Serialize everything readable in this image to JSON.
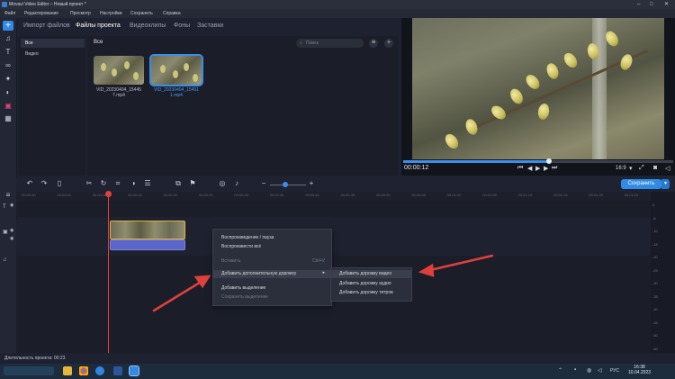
{
  "window": {
    "title": "Movavi Video Editor – Новый проект *"
  },
  "menu": [
    "Файл",
    "Редактирование",
    "Просмотр",
    "Настройки",
    "Сохранить",
    "Справка"
  ],
  "tabs": [
    "Импорт файлов",
    "Файлы проекта",
    "Видеоклипы",
    "Фоны",
    "Заставки"
  ],
  "media": {
    "categories": [
      "Все",
      "Видео"
    ],
    "header": "Все",
    "search_placeholder": "Поиск",
    "files": [
      {
        "name_line1": "VID_20230404_15445",
        "name_line2": "7.mp4",
        "selected": false
      },
      {
        "name_line1": "VID_20230404_15451",
        "name_line2": "1.mp4",
        "selected": true
      }
    ]
  },
  "player": {
    "timecode": "00:00:12",
    "aspect": "16:9",
    "progress": 0.54
  },
  "toolbar": {
    "save_label": "Сохранить"
  },
  "ruler": [
    "00:00:00",
    "00:00:05",
    "00:00:10",
    "00:00:15",
    "00:00:20",
    "00:00:25",
    "00:00:30",
    "00:00:35",
    "00:00:40",
    "00:00:45",
    "00:00:50",
    "00:00:55",
    "00:01:00",
    "00:01:05",
    "00:01:10",
    "00:01:15",
    "00:01:20",
    "00:01:25"
  ],
  "vu_scale": [
    "0",
    "-5",
    "-10",
    "-15",
    "-20",
    "-25",
    "-30",
    "-35",
    "-40",
    "-45",
    "-50",
    "-60"
  ],
  "context_menu": {
    "items": [
      {
        "label": "Воспроизведение / пауза",
        "shortcut": "",
        "disabled": false
      },
      {
        "label": "Воспроизвести всё",
        "shortcut": "",
        "disabled": false
      },
      {
        "label": "Вставить",
        "shortcut": "Ctrl+V",
        "disabled": true
      },
      {
        "label": "Добавить дополнительную дорожку",
        "shortcut": "",
        "disabled": false,
        "highlighted": true
      },
      {
        "label": "Добавить выделение",
        "shortcut": "",
        "disabled": false
      },
      {
        "label": "Сохранить выделение",
        "shortcut": "",
        "disabled": true
      }
    ],
    "submenu": [
      "Добавить дорожку видео",
      "Добавить дорожку аудио",
      "Добавить дорожку титров"
    ]
  },
  "status": {
    "duration_label": "Длительность проекта: 00:23"
  },
  "taskbar": {
    "time": "16:38",
    "date": "10.04.2023",
    "lang": "РУС"
  },
  "colors": {
    "accent": "#2f8be6",
    "playhead": "#e0403c",
    "clip_border": "#e2b13a",
    "annotation_arrow": "#e0403c"
  }
}
